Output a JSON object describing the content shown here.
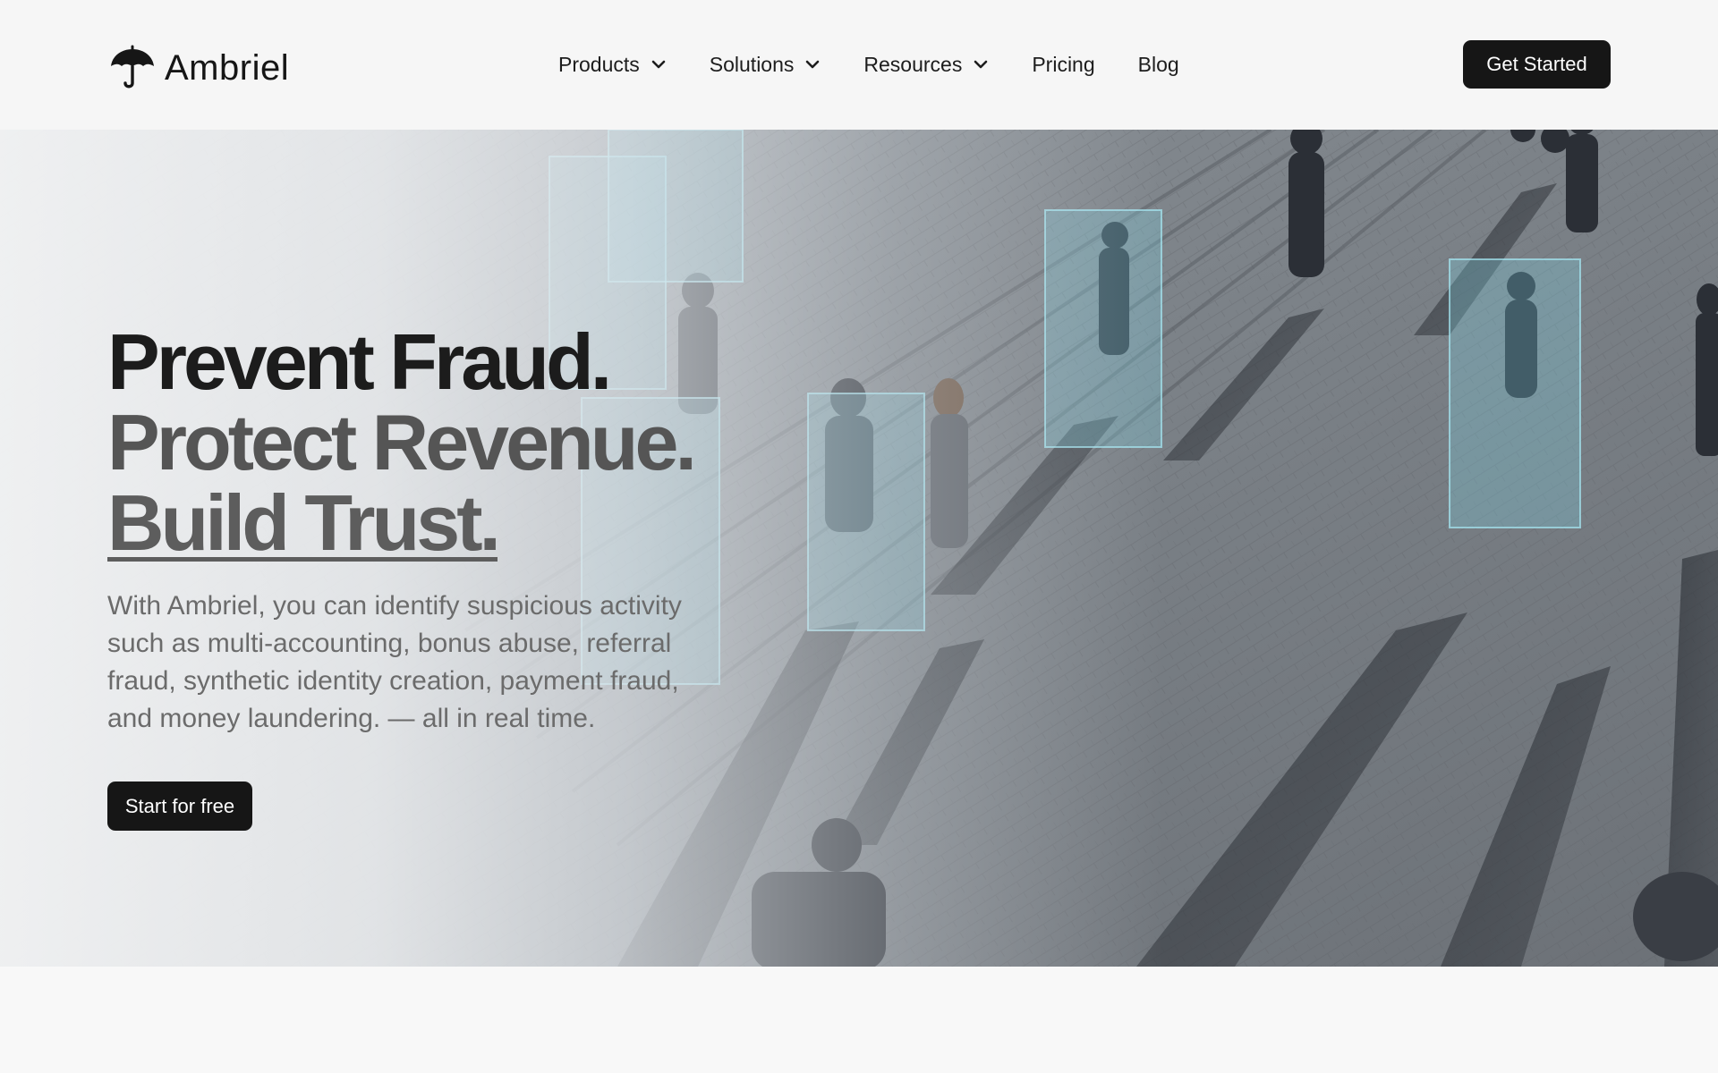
{
  "brand": {
    "name": "Ambriel",
    "logo_icon": "umbrella-icon"
  },
  "nav": {
    "items": [
      {
        "label": "Products",
        "has_dropdown": true
      },
      {
        "label": "Solutions",
        "has_dropdown": true
      },
      {
        "label": "Resources",
        "has_dropdown": true
      },
      {
        "label": "Pricing",
        "has_dropdown": false
      },
      {
        "label": "Blog",
        "has_dropdown": false
      }
    ],
    "dropdown_icon": "chevron-down-icon",
    "cta_label": "Get Started"
  },
  "hero": {
    "headline": [
      "Prevent Fraud.",
      "Protect Revenue.",
      "Build Trust."
    ],
    "description": "With Ambriel, you can identify suspicious activity such as multi-accounting, bonus abuse, referral fraud, synthetic identity creation, payment fraud, and money laundering. — all in real time.",
    "cta_label": "Start for free",
    "background": "aerial photo of people walking on a plaza with detection boxes"
  },
  "colors": {
    "primary_button": "#161616",
    "button_text": "#ffffff",
    "headline": "#1c1c1c",
    "headline_muted": "#555555",
    "body_text": "#6b6b6b",
    "detection_box": "#7fd8e8"
  }
}
